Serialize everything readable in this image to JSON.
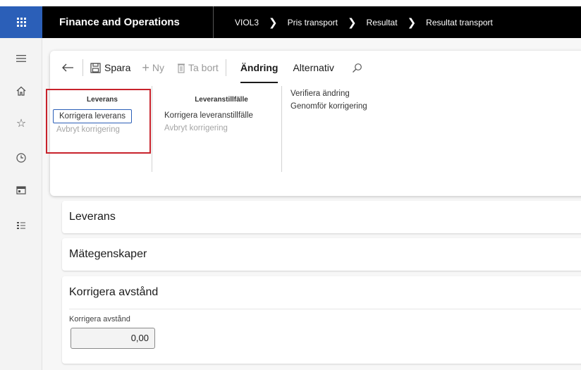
{
  "header": {
    "app_title": "Finance and Operations",
    "breadcrumbs": [
      "VIOL3",
      "Pris transport",
      "Resultat",
      "Resultat transport"
    ],
    "brand_color": "#2b5fb8"
  },
  "leftnav": {
    "icons": [
      "hamburger-icon",
      "home-icon",
      "star-icon",
      "clock-icon",
      "workspace-icon",
      "list-icon"
    ]
  },
  "toolbar": {
    "save_label": "Spara",
    "new_label": "Ny",
    "delete_label": "Ta bort",
    "tab_active": "Ändring",
    "tab_other": "Alternativ"
  },
  "groups": {
    "leverans": {
      "title": "Leverans",
      "correct": "Korrigera leverans",
      "cancel": "Avbryt korrigering"
    },
    "leveranstillfalle": {
      "title": "Leveranstillfälle",
      "correct": "Korrigera leveranstillfälle",
      "cancel": "Avbryt korrigering"
    },
    "actions": {
      "verify": "Verifiera ändring",
      "execute": "Genomför korrigering"
    }
  },
  "sections": {
    "leverans": "Leverans",
    "mategenskaper": "Mätegenskaper",
    "korrigera": "Korrigera avstånd"
  },
  "fields": {
    "korrigera_avstand_label": "Korrigera avstånd",
    "korrigera_avstand_value": "0,00"
  },
  "highlight_color": "#c8232c"
}
